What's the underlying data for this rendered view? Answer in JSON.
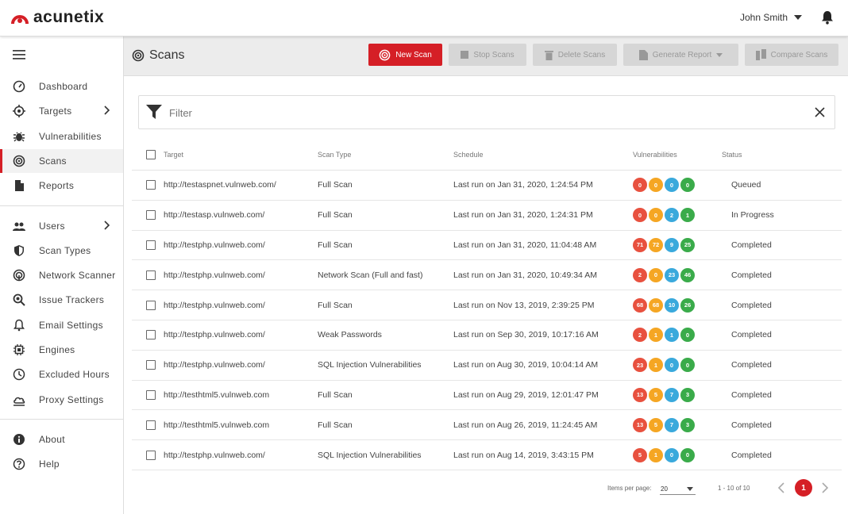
{
  "app": {
    "brand": "acunetix",
    "user_name": "John Smith"
  },
  "sidebar": {
    "items": [
      {
        "label": "Dashboard",
        "icon": "gauge-icon"
      },
      {
        "label": "Targets",
        "icon": "crosshair-icon"
      },
      {
        "label": "Vulnerabilities",
        "icon": "bug-icon"
      },
      {
        "label": "Scans",
        "icon": "radar-icon"
      },
      {
        "label": "Reports",
        "icon": "file-icon"
      },
      {
        "label": "Users",
        "icon": "users-icon"
      },
      {
        "label": "Scan Types",
        "icon": "shield-icon"
      },
      {
        "label": "Network Scanner",
        "icon": "network-icon"
      },
      {
        "label": "Issue Trackers",
        "icon": "magnifier-icon"
      },
      {
        "label": "Email Settings",
        "icon": "bell-icon"
      },
      {
        "label": "Engines",
        "icon": "chip-icon"
      },
      {
        "label": "Excluded Hours",
        "icon": "clock-icon"
      },
      {
        "label": "Proxy Settings",
        "icon": "cloud-icon"
      },
      {
        "label": "About",
        "icon": "info-icon"
      },
      {
        "label": "Help",
        "icon": "help-icon"
      }
    ]
  },
  "header": {
    "title": "Scans",
    "new_scan": "New Scan",
    "stop_scans": "Stop Scans",
    "delete_scans": "Delete Scans",
    "generate_report": "Generate Report",
    "compare_scans": "Compare Scans"
  },
  "filter": {
    "label": "Filter"
  },
  "table": {
    "columns": [
      "Target",
      "Scan Type",
      "Schedule",
      "Vulnerabilities",
      "Status"
    ],
    "rows": [
      {
        "target": "http://testaspnet.vulnweb.com/",
        "type": "Full Scan",
        "schedule": "Last run on Jan 31, 2020, 1:24:54 PM",
        "vulns": [
          "0",
          "0",
          "0",
          "0"
        ],
        "status": "Queued"
      },
      {
        "target": "http://testasp.vulnweb.com/",
        "type": "Full Scan",
        "schedule": "Last run on Jan 31, 2020, 1:24:31 PM",
        "vulns": [
          "0",
          "0",
          "2",
          "1"
        ],
        "status": "In Progress"
      },
      {
        "target": "http://testphp.vulnweb.com/",
        "type": "Full Scan",
        "schedule": "Last run on Jan 31, 2020, 11:04:48 AM",
        "vulns": [
          "71",
          "72",
          "9",
          "25"
        ],
        "status": "Completed"
      },
      {
        "target": "http://testphp.vulnweb.com/",
        "type": "Network Scan (Full and fast)",
        "schedule": "Last run on Jan 31, 2020, 10:49:34 AM",
        "vulns": [
          "2",
          "0",
          "23",
          "46"
        ],
        "status": "Completed"
      },
      {
        "target": "http://testphp.vulnweb.com/",
        "type": "Full Scan",
        "schedule": "Last run on Nov 13, 2019, 2:39:25 PM",
        "vulns": [
          "68",
          "68",
          "10",
          "26"
        ],
        "status": "Completed"
      },
      {
        "target": "http://testphp.vulnweb.com/",
        "type": "Weak Passwords",
        "schedule": "Last run on Sep 30, 2019, 10:17:16 AM",
        "vulns": [
          "2",
          "1",
          "1",
          "0"
        ],
        "status": "Completed"
      },
      {
        "target": "http://testphp.vulnweb.com/",
        "type": "SQL Injection Vulnerabilities",
        "schedule": "Last run on Aug 30, 2019, 10:04:14 AM",
        "vulns": [
          "23",
          "1",
          "0",
          "0"
        ],
        "status": "Completed"
      },
      {
        "target": "http://testhtml5.vulnweb.com",
        "type": "Full Scan",
        "schedule": "Last run on Aug 29, 2019, 12:01:47 PM",
        "vulns": [
          "13",
          "5",
          "7",
          "3"
        ],
        "status": "Completed"
      },
      {
        "target": "http://testhtml5.vulnweb.com",
        "type": "Full Scan",
        "schedule": "Last run on Aug 26, 2019, 11:24:45 AM",
        "vulns": [
          "13",
          "5",
          "7",
          "3"
        ],
        "status": "Completed"
      },
      {
        "target": "http://testphp.vulnweb.com/",
        "type": "SQL Injection Vulnerabilities",
        "schedule": "Last run on Aug 14, 2019, 3:43:15 PM",
        "vulns": [
          "5",
          "1",
          "0",
          "0"
        ],
        "status": "Completed"
      }
    ]
  },
  "severity_colors": [
    "#e8513f",
    "#f5a623",
    "#3aa9dc",
    "#3aab4a"
  ],
  "pagination": {
    "items_per_page_label": "Items per page:",
    "items_per_page": "20",
    "range": "1 - 10 of 10",
    "current_page": "1"
  }
}
